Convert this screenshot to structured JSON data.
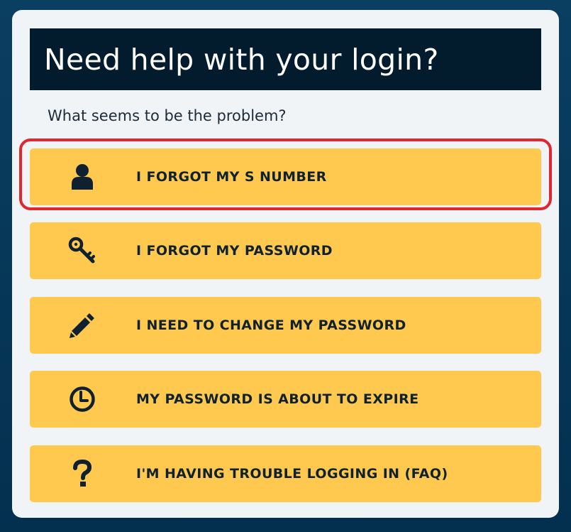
{
  "header": {
    "title": "Need help with your login?"
  },
  "subtitle": "What seems to be the problem?",
  "options": [
    {
      "label": "I FORGOT MY S NUMBER",
      "icon": "user-icon"
    },
    {
      "label": "I FORGOT MY PASSWORD",
      "icon": "key-icon"
    },
    {
      "label": "I NEED TO CHANGE MY PASSWORD",
      "icon": "pencil-icon"
    },
    {
      "label": "MY PASSWORD IS ABOUT TO EXPIRE",
      "icon": "clock-icon"
    },
    {
      "label": "I'M HAVING TROUBLE LOGGING IN (FAQ)",
      "icon": "question-icon"
    }
  ],
  "highlighted_option": "I FORGOT MY S NUMBER",
  "colors": {
    "background": "#063a5c",
    "card": "#f1f4f7",
    "header": "#021c2e",
    "option": "#ffc94f",
    "highlight": "#e0262f",
    "text_dark": "#10212f"
  }
}
